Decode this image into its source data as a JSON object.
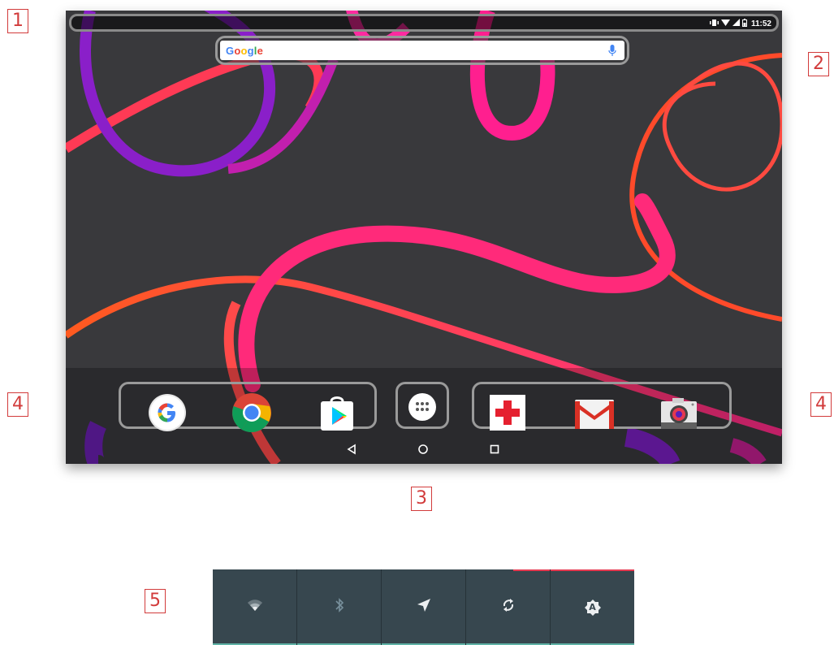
{
  "callouts": [
    "1",
    "2",
    "3",
    "4",
    "4",
    "5"
  ],
  "status_bar": {
    "time": "11:52",
    "icons": [
      "vibrate-icon",
      "wifi-icon",
      "signal-icon",
      "battery-icon"
    ]
  },
  "search": {
    "logo_text": "Google",
    "mic_icon": "mic-icon"
  },
  "dock": {
    "left_apps": [
      "google-app-icon",
      "chrome-icon",
      "play-store-icon"
    ],
    "app_drawer": "app-drawer-icon",
    "right_apps": [
      "first-aid-app-icon",
      "gmail-icon",
      "camera-icon"
    ]
  },
  "navigation": {
    "buttons": [
      "back-icon",
      "home-icon",
      "recents-icon"
    ]
  },
  "quick_settings": {
    "tiles": [
      "wifi-icon",
      "bluetooth-icon",
      "location-icon",
      "auto-rotate-icon",
      "auto-brightness-icon"
    ],
    "brightness_letter": "A"
  },
  "colors": {
    "wallpaper_bg": "#39393c",
    "callout": "#d23b3b",
    "quick_settings_bg": "#37474f",
    "quick_settings_accent": "#5fb3a6"
  }
}
